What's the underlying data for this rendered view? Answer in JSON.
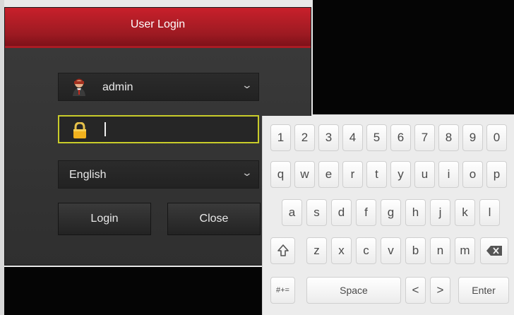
{
  "dialog": {
    "title": "User Login",
    "username": "admin",
    "password": "",
    "language": "English",
    "login_label": "Login",
    "close_label": "Close"
  },
  "keyboard": {
    "row1": [
      "1",
      "2",
      "3",
      "4",
      "5",
      "6",
      "7",
      "8",
      "9",
      "0"
    ],
    "row2": [
      "q",
      "w",
      "e",
      "r",
      "t",
      "y",
      "u",
      "i",
      "o",
      "p"
    ],
    "row3": [
      "a",
      "s",
      "d",
      "f",
      "g",
      "h",
      "j",
      "k",
      "l"
    ],
    "row4": [
      "z",
      "x",
      "c",
      "v",
      "b",
      "n",
      "m"
    ],
    "symbols_label": "#+=",
    "space_label": "Space",
    "left_label": "<",
    "right_label": ">",
    "enter_label": "Enter",
    "shift_icon": "shift-icon",
    "backspace_icon": "backspace-icon"
  },
  "colors": {
    "header_red": "#c8202b",
    "focus_outline": "#c9cc2a",
    "dialog_bg": "#333333",
    "keyboard_bg": "#ececec"
  }
}
